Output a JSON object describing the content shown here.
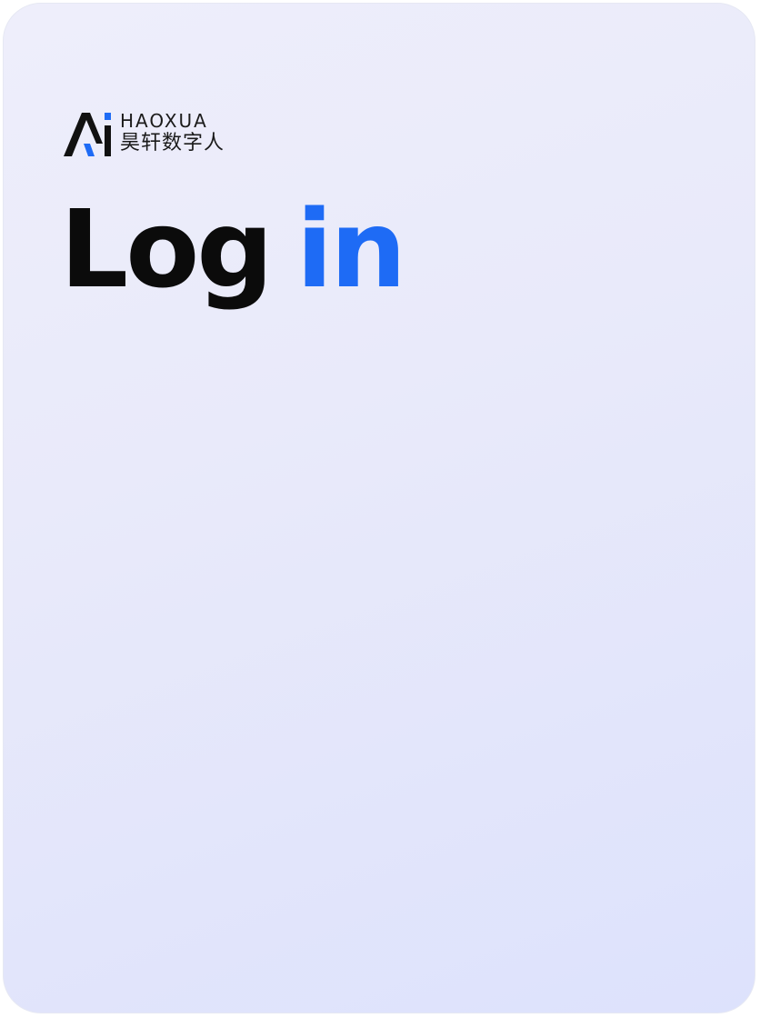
{
  "brand": {
    "name_en": "HAOXUA",
    "name_cn": "昊轩数字人"
  },
  "title": {
    "part1": "Log",
    "part2": "in"
  },
  "colors": {
    "accent": "#1e6bf5",
    "text": "#0b0b0b",
    "logo_dark": "#111111",
    "logo_accent": "#1e6bf5"
  },
  "icons": {
    "logo": "ai-logo-icon"
  }
}
